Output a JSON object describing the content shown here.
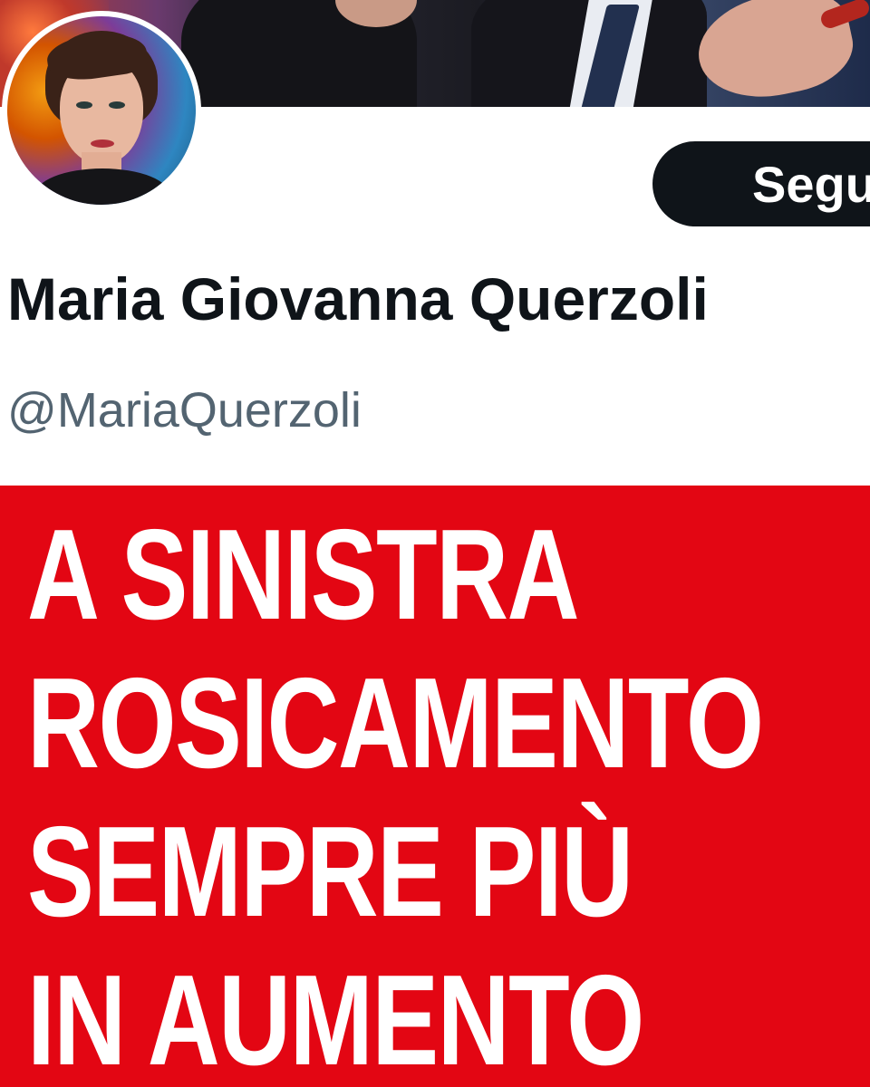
{
  "profile": {
    "follow_label": "Segui",
    "display_name": "Maria Giovanna Querzoli",
    "handle": "@MariaQuerzoli"
  },
  "post_image": {
    "lines": [
      "A SINISTRA",
      "ROSICAMENTO",
      "SEMPRE PIÙ",
      "IN AUMENTO"
    ],
    "background_color": "#e30613",
    "text_color": "#ffffff"
  },
  "colors": {
    "follow_button_bg": "#0f1419",
    "name_color": "#0f1419",
    "handle_color": "#536471"
  }
}
